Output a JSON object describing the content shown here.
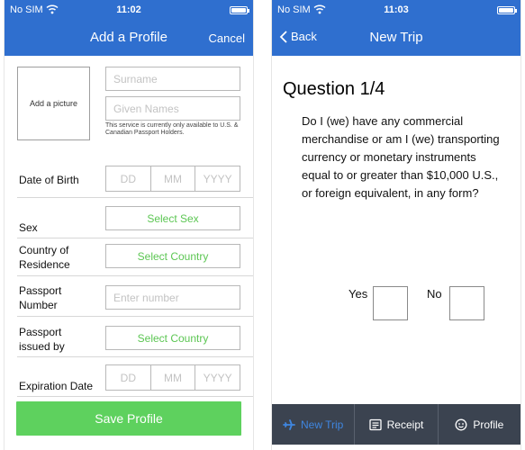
{
  "status": {
    "carrier": "No SIM",
    "time": "11:02",
    "time_right": "11:03"
  },
  "left": {
    "nav_title": "Add a Profile",
    "nav_cancel": "Cancel",
    "add_picture": "Add a picture",
    "surname_placeholder": "Surname",
    "given_names_placeholder": "Given Names",
    "service_note": "This service is currently only available to U.S. & Canadian Passport Holders.",
    "date_of_birth_label": "Date of Birth",
    "dob": {
      "dd": "DD",
      "mm": "MM",
      "yyyy": "YYYY"
    },
    "sex_label": "Sex",
    "select_sex": "Select Sex",
    "country_residence_label_1": "Country of",
    "country_residence_label_2": "Residence",
    "select_country": "Select Country",
    "passport_number_label_1": "Passport",
    "passport_number_label_2": "Number",
    "enter_number_placeholder": "Enter number",
    "passport_issued_label_1": "Passport",
    "passport_issued_label_2": "issued by",
    "select_country_2": "Select Country",
    "expiration_label": "Expiration Date",
    "exp": {
      "dd": "DD",
      "mm": "MM",
      "yyyy": "YYYY"
    },
    "save_button": "Save Profile"
  },
  "right": {
    "back": "Back",
    "nav_title": "New Trip",
    "question_title": "Question 1/4",
    "question_text": "Do I (we) have any commercial merchandise or am I (we) transporting currency or monetary instruments equal to or greater than $10,000 U.S., or foreign equivalent, in any form?",
    "yes": "Yes",
    "no": "No",
    "tabs": [
      {
        "label": "New Trip",
        "icon": "airplane-icon",
        "active": true
      },
      {
        "label": "Receipt",
        "icon": "receipt-icon",
        "active": false
      },
      {
        "label": "Profile",
        "icon": "face-icon",
        "active": false
      }
    ]
  },
  "colors": {
    "nav_blue": "#2f6fcf",
    "accent_green": "#5cc653",
    "save_green": "#5ed15e",
    "tabbar": "#3b4350",
    "tab_active": "#3f86e0"
  }
}
